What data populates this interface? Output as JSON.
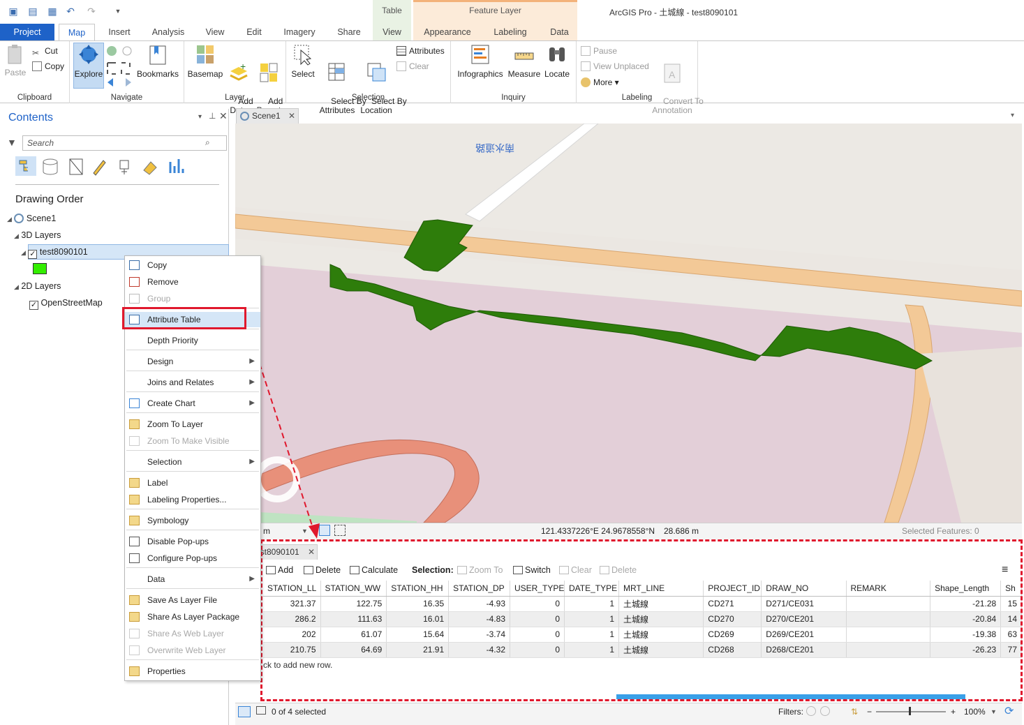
{
  "app": {
    "title": "ArcGIS Pro - 土城線 - test8090101"
  },
  "contextual_tabs": {
    "table": "Table",
    "feature_layer": "Feature Layer"
  },
  "tabs": [
    "Project",
    "Map",
    "Insert",
    "Analysis",
    "View",
    "Edit",
    "Imagery",
    "Share",
    "View",
    "Appearance",
    "Labeling",
    "Data"
  ],
  "ribbon": {
    "clipboard": {
      "label": "Clipboard",
      "paste": "Paste",
      "cut": "Cut",
      "copy": "Copy"
    },
    "navigate": {
      "label": "Navigate",
      "explore": "Explore",
      "bookmarks": "Bookmarks"
    },
    "layer": {
      "label": "Layer",
      "basemap": "Basemap",
      "add_data": "Add\nData",
      "add_preset": "Add\nPreset"
    },
    "selection": {
      "label": "Selection",
      "select": "Select",
      "by_attr": "Select By\nAttributes",
      "by_loc": "Select By\nLocation",
      "attributes": "Attributes",
      "clear": "Clear"
    },
    "inquiry": {
      "label": "Inquiry",
      "infographics": "Infographics",
      "measure": "Measure",
      "locate": "Locate"
    },
    "labeling": {
      "label": "Labeling",
      "pause": "Pause",
      "view_unplaced": "View Unplaced",
      "more": "More",
      "convert": "Convert To\nAnnotation"
    }
  },
  "contents": {
    "title": "Contents",
    "search_placeholder": "Search",
    "drawing_order": "Drawing Order",
    "scene": "Scene1",
    "layers_3d": "3D Layers",
    "layer_name": "test8090101",
    "layers_2d": "2D Layers",
    "osm": "OpenStreetMap",
    "symbol_color": "#33ee00"
  },
  "context_menu": [
    {
      "label": "Copy",
      "enabled": true
    },
    {
      "label": "Remove",
      "enabled": true
    },
    {
      "label": "Group",
      "enabled": false
    },
    {
      "label": "Attribute Table",
      "enabled": true
    },
    {
      "label": "Depth Priority",
      "enabled": true
    },
    {
      "label": "Design",
      "enabled": true,
      "submenu": true
    },
    {
      "label": "Joins and Relates",
      "enabled": true,
      "submenu": true
    },
    {
      "label": "Create Chart",
      "enabled": true,
      "submenu": true
    },
    {
      "label": "Zoom To Layer",
      "enabled": true
    },
    {
      "label": "Zoom To Make Visible",
      "enabled": false
    },
    {
      "label": "Selection",
      "enabled": true,
      "submenu": true
    },
    {
      "label": "Label",
      "enabled": true
    },
    {
      "label": "Labeling Properties...",
      "enabled": true
    },
    {
      "label": "Symbology",
      "enabled": true
    },
    {
      "label": "Disable Pop-ups",
      "enabled": true
    },
    {
      "label": "Configure Pop-ups",
      "enabled": true
    },
    {
      "label": "Data",
      "enabled": true,
      "submenu": true
    },
    {
      "label": "Save As Layer File",
      "enabled": true
    },
    {
      "label": "Share As Layer Package",
      "enabled": true
    },
    {
      "label": "Share As Web Layer",
      "enabled": false
    },
    {
      "label": "Overwrite Web Layer",
      "enabled": false
    },
    {
      "label": "Properties",
      "enabled": true
    }
  ],
  "scene_tab": "Scene1",
  "map_status": {
    "scale": "m",
    "coords": "121.4337226°E 24.9678558°N",
    "elevation": "28.686 m",
    "selected": "Selected Features: 0"
  },
  "attribute_table": {
    "tab": "test8090101",
    "tab_visible": "est8090101",
    "toolbar": {
      "add": "Add",
      "delete": "Delete",
      "calculate": "Calculate",
      "selection": "Selection:",
      "zoom_to": "Zoom To",
      "switch": "Switch",
      "clear": "Clear",
      "delete2": "Delete"
    },
    "columns": [
      "STATION_LL",
      "STATION_WW",
      "STATION_HH",
      "STATION_DP",
      "USER_TYPE",
      "DATE_TYPE",
      "MRT_LINE",
      "PROJECT_ID",
      "DRAW_NO",
      "REMARK",
      "Shape_Length",
      "Sh"
    ],
    "rows": [
      [
        "321.37",
        "122.75",
        "16.35",
        "-4.93",
        "0",
        "1",
        "土城線",
        "CD271",
        "D271/CE031",
        "",
        "-21.28",
        "15"
      ],
      [
        "286.2",
        "111.63",
        "16.01",
        "-4.83",
        "0",
        "1",
        "土城線",
        "CD270",
        "D270/CE201",
        "",
        "-20.84",
        "14"
      ],
      [
        "202",
        "61.07",
        "15.64",
        "-3.74",
        "0",
        "1",
        "土城線",
        "CD269",
        "D269/CE201",
        "",
        "-19.38",
        "63"
      ],
      [
        "210.75",
        "64.69",
        "21.91",
        "-4.32",
        "0",
        "1",
        "土城線",
        "CD268",
        "D268/CE201",
        "",
        "-26.23",
        "77"
      ]
    ],
    "add_row_hint": "ck to add new row.",
    "selected_count": "0 of 4 selected",
    "filters": "Filters:",
    "zoom": "100%"
  }
}
